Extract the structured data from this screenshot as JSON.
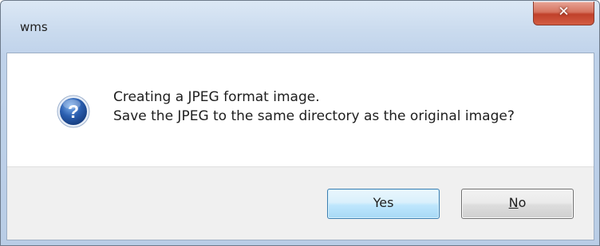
{
  "window": {
    "title": "wms",
    "close_icon": "close-icon"
  },
  "message": {
    "icon": "question-icon",
    "line1": "Creating a JPEG format image.",
    "line2": "Save the JPEG to the same directory as the original image?"
  },
  "buttons": {
    "yes_label": "Yes",
    "no_mnemonic": "N",
    "no_rest": "o"
  },
  "colors": {
    "titlebar": "#c9daee",
    "close_button": "#c0402a",
    "default_button_border": "#3c7fb1",
    "question_icon": "#2b5fb0"
  }
}
